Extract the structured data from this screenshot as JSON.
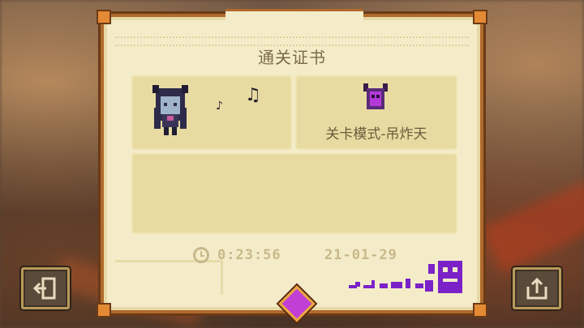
{
  "certificate": {
    "title": "通关证书",
    "mode_label": "关卡模式-吊炸天",
    "time": "0:23:56",
    "date": "21-01-29"
  },
  "icons": {
    "exit": "exit-door-icon",
    "share": "share-icon",
    "clock": "clock-icon",
    "helmet": "horned-helmet-icon",
    "gem": "purple-gem-icon",
    "notes": "music-note-icon"
  },
  "colors": {
    "card_bg": "#f4ecc9",
    "panel_bg": "#e8dba1",
    "frame": "#b06a2c",
    "text": "#6b5a3c",
    "stat_text": "#c8b88a",
    "gem": "#c23fd6",
    "signature": "#7a22c8"
  }
}
